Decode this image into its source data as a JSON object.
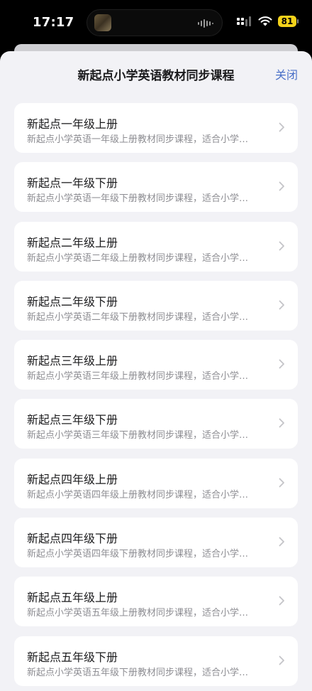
{
  "status": {
    "time": "17:17",
    "battery": "81",
    "signal_icon": "signal-bars-icon",
    "wifi_icon": "wifi-icon"
  },
  "sheet": {
    "title": "新起点小学英语教材同步课程",
    "close_label": "关闭",
    "accent_color": "#4a70c8"
  },
  "courses": [
    {
      "title": "新起点一年级上册",
      "desc": "新起点小学英语一年级上册教材同步课程，适合小学…"
    },
    {
      "title": "新起点一年级下册",
      "desc": "新起点小学英语一年级下册教材同步课程，适合小学…"
    },
    {
      "title": "新起点二年级上册",
      "desc": "新起点小学英语二年级上册教材同步课程，适合小学…"
    },
    {
      "title": "新起点二年级下册",
      "desc": "新起点小学英语二年级下册教材同步课程，适合小学…"
    },
    {
      "title": "新起点三年级上册",
      "desc": "新起点小学英语三年级上册教材同步课程，适合小学…"
    },
    {
      "title": "新起点三年级下册",
      "desc": "新起点小学英语三年级下册教材同步课程，适合小学…"
    },
    {
      "title": "新起点四年级上册",
      "desc": "新起点小学英语四年级上册教材同步课程，适合小学…"
    },
    {
      "title": "新起点四年级下册",
      "desc": "新起点小学英语四年级下册教材同步课程，适合小学…"
    },
    {
      "title": "新起点五年级上册",
      "desc": "新起点小学英语五年级上册教材同步课程，适合小学…"
    },
    {
      "title": "新起点五年级下册",
      "desc": "新起点小学英语五年级下册教材同步课程，适合小学…"
    }
  ]
}
